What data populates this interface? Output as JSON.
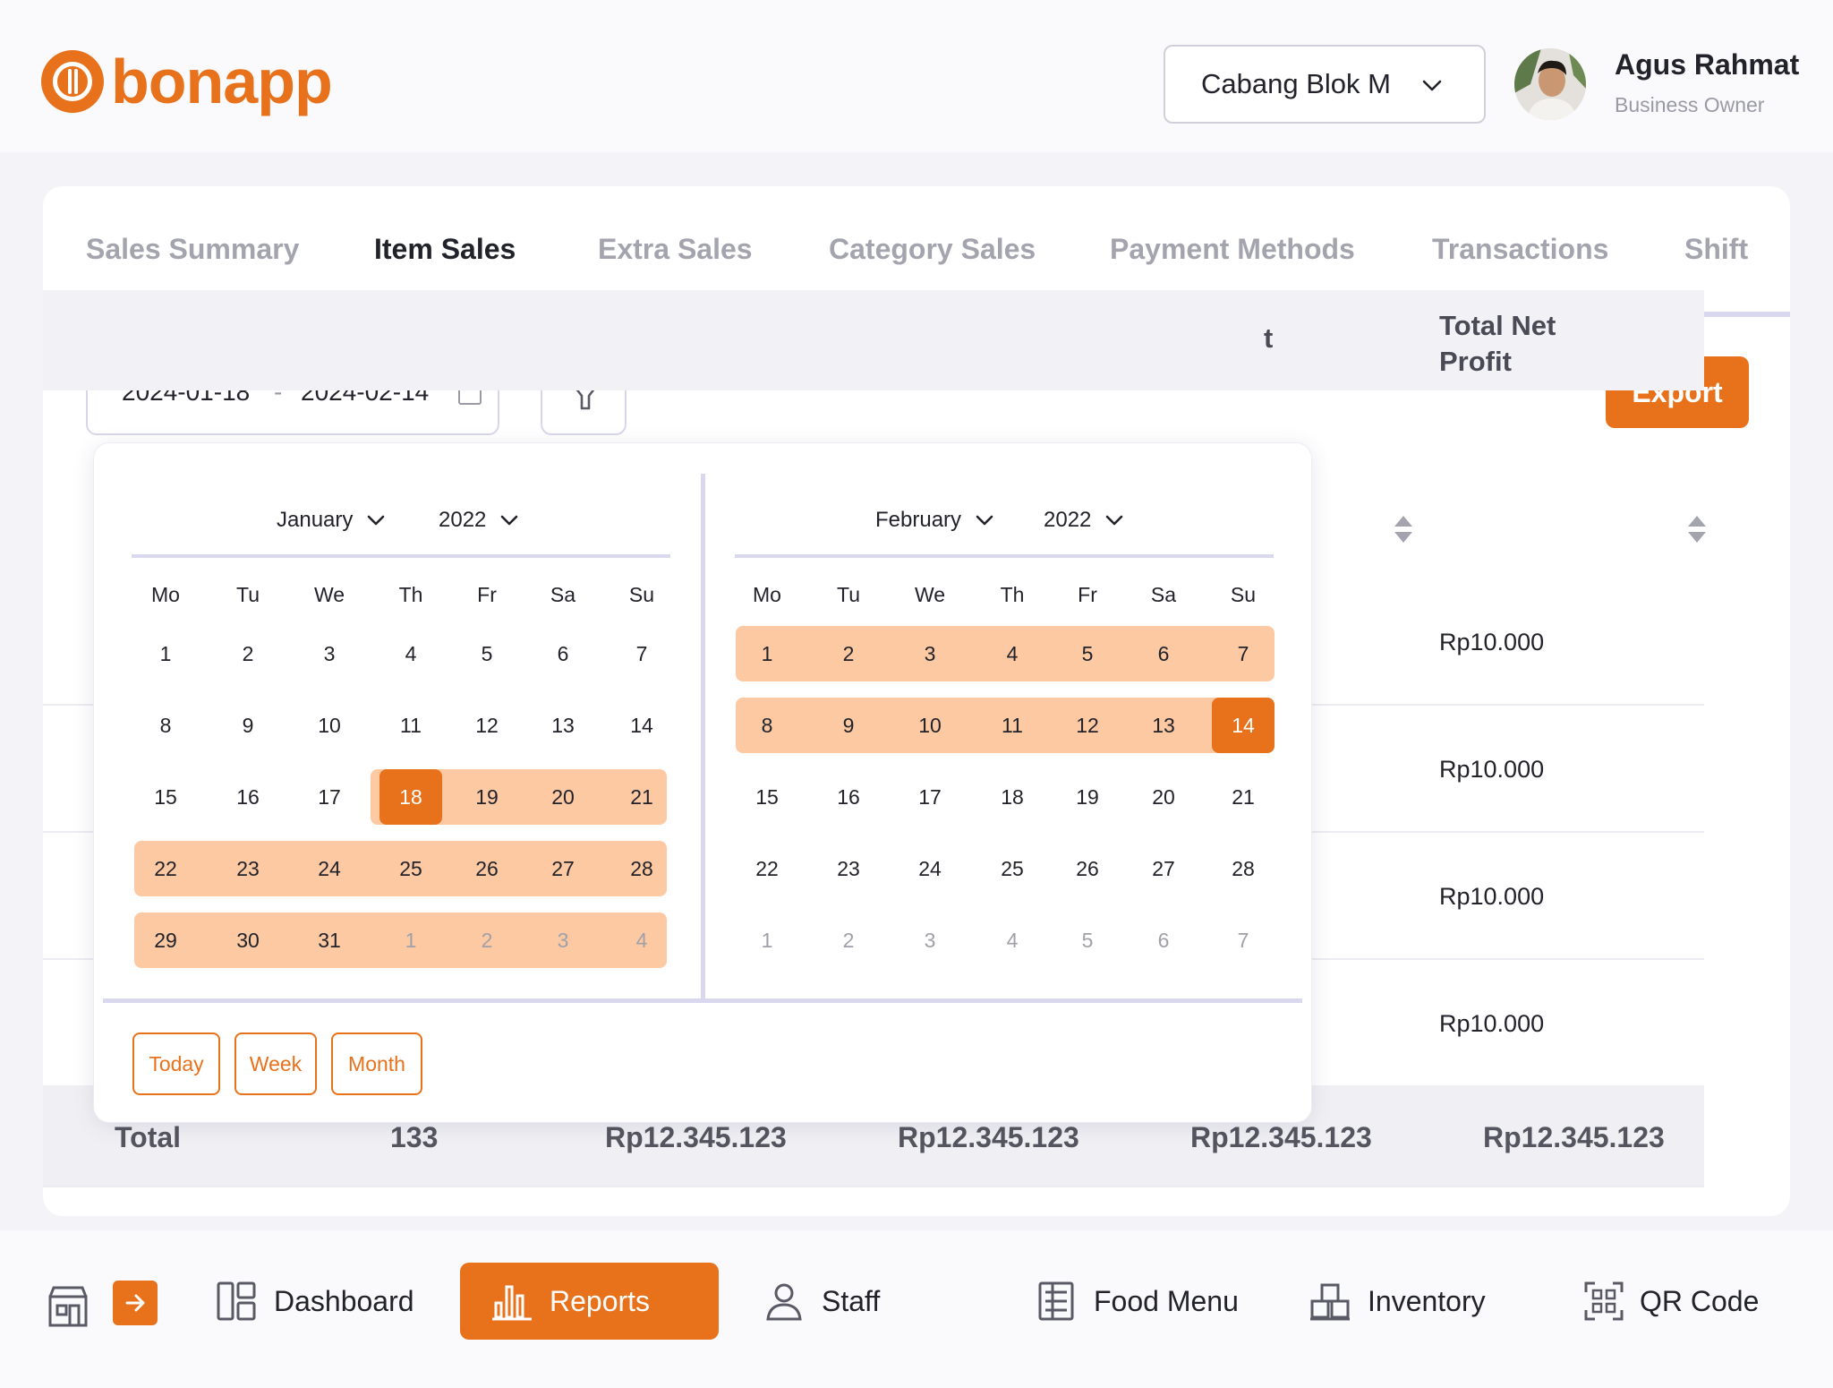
{
  "brand": {
    "name": "bonapp",
    "accent": "#e8711c"
  },
  "header": {
    "branch_select": "Cabang Blok M",
    "user_name": "Agus Rahmat",
    "user_role": "Business Owner"
  },
  "tabs": [
    {
      "label": "Sales Summary",
      "active": false
    },
    {
      "label": "Item Sales",
      "active": true
    },
    {
      "label": "Extra Sales",
      "active": false
    },
    {
      "label": "Category Sales",
      "active": false
    },
    {
      "label": "Payment Methods",
      "active": false
    },
    {
      "label": "Transactions",
      "active": false
    },
    {
      "label": "Shift",
      "active": false
    }
  ],
  "toolbar": {
    "date_from": "2024-01-18",
    "date_sep": "-",
    "date_to": "2024-02-14",
    "export_label": "Export"
  },
  "table": {
    "headers": {
      "partial": "t",
      "net_profit": [
        "Total Net",
        "Profit"
      ]
    },
    "rows": [
      "Rp10.000",
      "Rp10.000",
      "Rp10.000",
      "Rp10.000"
    ],
    "total": {
      "label": "Total",
      "qty": "133",
      "c1": "Rp12.345.123",
      "c2": "Rp12.345.123",
      "c3": "Rp12.345.123",
      "c4": "Rp12.345.123"
    }
  },
  "datepicker": {
    "left": {
      "month": "January",
      "year": "2022"
    },
    "right": {
      "month": "February",
      "year": "2022"
    },
    "weekdays": [
      "Mo",
      "Tu",
      "We",
      "Th",
      "Fr",
      "Sa",
      "Su"
    ],
    "quick": [
      "Today",
      "Week",
      "Month"
    ]
  },
  "nav": {
    "dashboard": "Dashboard",
    "reports": "Reports",
    "staff": "Staff",
    "food_menu": "Food Menu",
    "inventory": "Inventory",
    "qr_code": "QR Code"
  }
}
